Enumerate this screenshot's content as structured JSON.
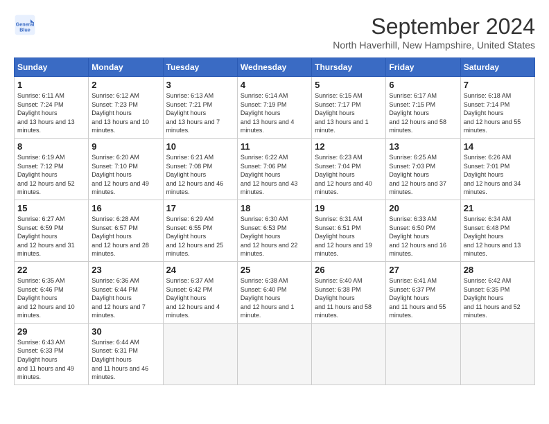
{
  "header": {
    "logo_line1": "General",
    "logo_line2": "Blue",
    "month_title": "September 2024",
    "location": "North Haverhill, New Hampshire, United States"
  },
  "weekdays": [
    "Sunday",
    "Monday",
    "Tuesday",
    "Wednesday",
    "Thursday",
    "Friday",
    "Saturday"
  ],
  "weeks": [
    [
      {
        "day": "1",
        "sunrise": "6:11 AM",
        "sunset": "7:24 PM",
        "daylight": "13 hours and 13 minutes."
      },
      {
        "day": "2",
        "sunrise": "6:12 AM",
        "sunset": "7:23 PM",
        "daylight": "13 hours and 10 minutes."
      },
      {
        "day": "3",
        "sunrise": "6:13 AM",
        "sunset": "7:21 PM",
        "daylight": "13 hours and 7 minutes."
      },
      {
        "day": "4",
        "sunrise": "6:14 AM",
        "sunset": "7:19 PM",
        "daylight": "13 hours and 4 minutes."
      },
      {
        "day": "5",
        "sunrise": "6:15 AM",
        "sunset": "7:17 PM",
        "daylight": "13 hours and 1 minute."
      },
      {
        "day": "6",
        "sunrise": "6:17 AM",
        "sunset": "7:15 PM",
        "daylight": "12 hours and 58 minutes."
      },
      {
        "day": "7",
        "sunrise": "6:18 AM",
        "sunset": "7:14 PM",
        "daylight": "12 hours and 55 minutes."
      }
    ],
    [
      {
        "day": "8",
        "sunrise": "6:19 AM",
        "sunset": "7:12 PM",
        "daylight": "12 hours and 52 minutes."
      },
      {
        "day": "9",
        "sunrise": "6:20 AM",
        "sunset": "7:10 PM",
        "daylight": "12 hours and 49 minutes."
      },
      {
        "day": "10",
        "sunrise": "6:21 AM",
        "sunset": "7:08 PM",
        "daylight": "12 hours and 46 minutes."
      },
      {
        "day": "11",
        "sunrise": "6:22 AM",
        "sunset": "7:06 PM",
        "daylight": "12 hours and 43 minutes."
      },
      {
        "day": "12",
        "sunrise": "6:23 AM",
        "sunset": "7:04 PM",
        "daylight": "12 hours and 40 minutes."
      },
      {
        "day": "13",
        "sunrise": "6:25 AM",
        "sunset": "7:03 PM",
        "daylight": "12 hours and 37 minutes."
      },
      {
        "day": "14",
        "sunrise": "6:26 AM",
        "sunset": "7:01 PM",
        "daylight": "12 hours and 34 minutes."
      }
    ],
    [
      {
        "day": "15",
        "sunrise": "6:27 AM",
        "sunset": "6:59 PM",
        "daylight": "12 hours and 31 minutes."
      },
      {
        "day": "16",
        "sunrise": "6:28 AM",
        "sunset": "6:57 PM",
        "daylight": "12 hours and 28 minutes."
      },
      {
        "day": "17",
        "sunrise": "6:29 AM",
        "sunset": "6:55 PM",
        "daylight": "12 hours and 25 minutes."
      },
      {
        "day": "18",
        "sunrise": "6:30 AM",
        "sunset": "6:53 PM",
        "daylight": "12 hours and 22 minutes."
      },
      {
        "day": "19",
        "sunrise": "6:31 AM",
        "sunset": "6:51 PM",
        "daylight": "12 hours and 19 minutes."
      },
      {
        "day": "20",
        "sunrise": "6:33 AM",
        "sunset": "6:50 PM",
        "daylight": "12 hours and 16 minutes."
      },
      {
        "day": "21",
        "sunrise": "6:34 AM",
        "sunset": "6:48 PM",
        "daylight": "12 hours and 13 minutes."
      }
    ],
    [
      {
        "day": "22",
        "sunrise": "6:35 AM",
        "sunset": "6:46 PM",
        "daylight": "12 hours and 10 minutes."
      },
      {
        "day": "23",
        "sunrise": "6:36 AM",
        "sunset": "6:44 PM",
        "daylight": "12 hours and 7 minutes."
      },
      {
        "day": "24",
        "sunrise": "6:37 AM",
        "sunset": "6:42 PM",
        "daylight": "12 hours and 4 minutes."
      },
      {
        "day": "25",
        "sunrise": "6:38 AM",
        "sunset": "6:40 PM",
        "daylight": "12 hours and 1 minute."
      },
      {
        "day": "26",
        "sunrise": "6:40 AM",
        "sunset": "6:38 PM",
        "daylight": "11 hours and 58 minutes."
      },
      {
        "day": "27",
        "sunrise": "6:41 AM",
        "sunset": "6:37 PM",
        "daylight": "11 hours and 55 minutes."
      },
      {
        "day": "28",
        "sunrise": "6:42 AM",
        "sunset": "6:35 PM",
        "daylight": "11 hours and 52 minutes."
      }
    ],
    [
      {
        "day": "29",
        "sunrise": "6:43 AM",
        "sunset": "6:33 PM",
        "daylight": "11 hours and 49 minutes."
      },
      {
        "day": "30",
        "sunrise": "6:44 AM",
        "sunset": "6:31 PM",
        "daylight": "11 hours and 46 minutes."
      },
      null,
      null,
      null,
      null,
      null
    ]
  ]
}
